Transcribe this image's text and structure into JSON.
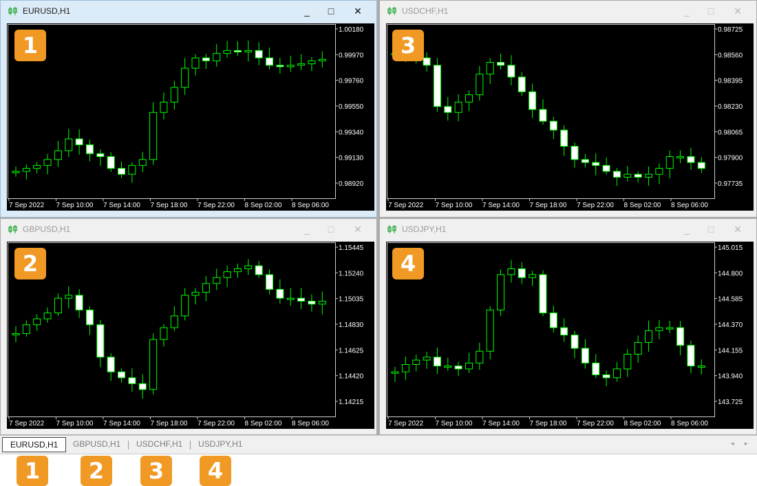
{
  "windows": [
    {
      "id": "eurusd",
      "title": "EURUSD,H1",
      "active": true,
      "badge": "1",
      "chart": {
        "prices": [
          "1.00180",
          "0.99970",
          "0.99760",
          "0.99550",
          "0.99340",
          "0.99130",
          "0.98920"
        ],
        "times": [
          "7 Sep 2022",
          "7 Sep 10:00",
          "7 Sep 14:00",
          "7 Sep 18:00",
          "7 Sep 22:00",
          "8 Sep 02:00",
          "8 Sep 06:00"
        ]
      }
    },
    {
      "id": "usdchf",
      "title": "USDCHF,H1",
      "active": false,
      "badge": "3",
      "chart": {
        "prices": [
          "0.98725",
          "0.98560",
          "0.98395",
          "0.98230",
          "0.98065",
          "0.97900",
          "0.97735"
        ],
        "times": [
          "7 Sep 2022",
          "7 Sep 10:00",
          "7 Sep 14:00",
          "7 Sep 18:00",
          "7 Sep 22:00",
          "8 Sep 02:00",
          "8 Sep 06:00"
        ]
      }
    },
    {
      "id": "gbpusd",
      "title": "GBPUSD,H1",
      "active": false,
      "badge": "2",
      "chart": {
        "prices": [
          "1.15445",
          "1.15240",
          "1.15035",
          "1.14830",
          "1.14625",
          "1.14420",
          "1.14215"
        ],
        "times": [
          "7 Sep 2022",
          "7 Sep 10:00",
          "7 Sep 14:00",
          "7 Sep 18:00",
          "7 Sep 22:00",
          "8 Sep 02:00",
          "8 Sep 06:00"
        ]
      }
    },
    {
      "id": "usdjpy",
      "title": "USDJPY,H1",
      "active": false,
      "badge": "4",
      "chart": {
        "prices": [
          "145.015",
          "144.800",
          "144.585",
          "144.370",
          "144.155",
          "143.940",
          "143.725"
        ],
        "times": [
          "7 Sep 2022",
          "7 Sep 10:00",
          "7 Sep 14:00",
          "7 Sep 18:00",
          "7 Sep 22:00",
          "8 Sep 02:00",
          "8 Sep 06:00"
        ]
      }
    }
  ],
  "window_controls": {
    "minimize": "_",
    "maximize": "□",
    "close": "✕"
  },
  "tabs": [
    {
      "label": "EURUSD,H1",
      "badge": "1",
      "active": true
    },
    {
      "label": "GBPUSD,H1",
      "badge": "2",
      "active": false
    },
    {
      "label": "USDCHF,H1",
      "badge": "3",
      "active": false
    },
    {
      "label": "USDJPY,H1",
      "badge": "4",
      "active": false
    }
  ],
  "tabbar_scroll": {
    "left": "◂",
    "right": "▸"
  },
  "colors": {
    "chart_bg": "#000000",
    "candle_up_outline": "#00ff00",
    "candle_down_fill": "#ffffff",
    "grid_text": "#ffffff",
    "badge": "#f09a25",
    "title_icon": "#1aa32a"
  },
  "icons": {
    "window": "candlestick-chart-icon"
  }
}
